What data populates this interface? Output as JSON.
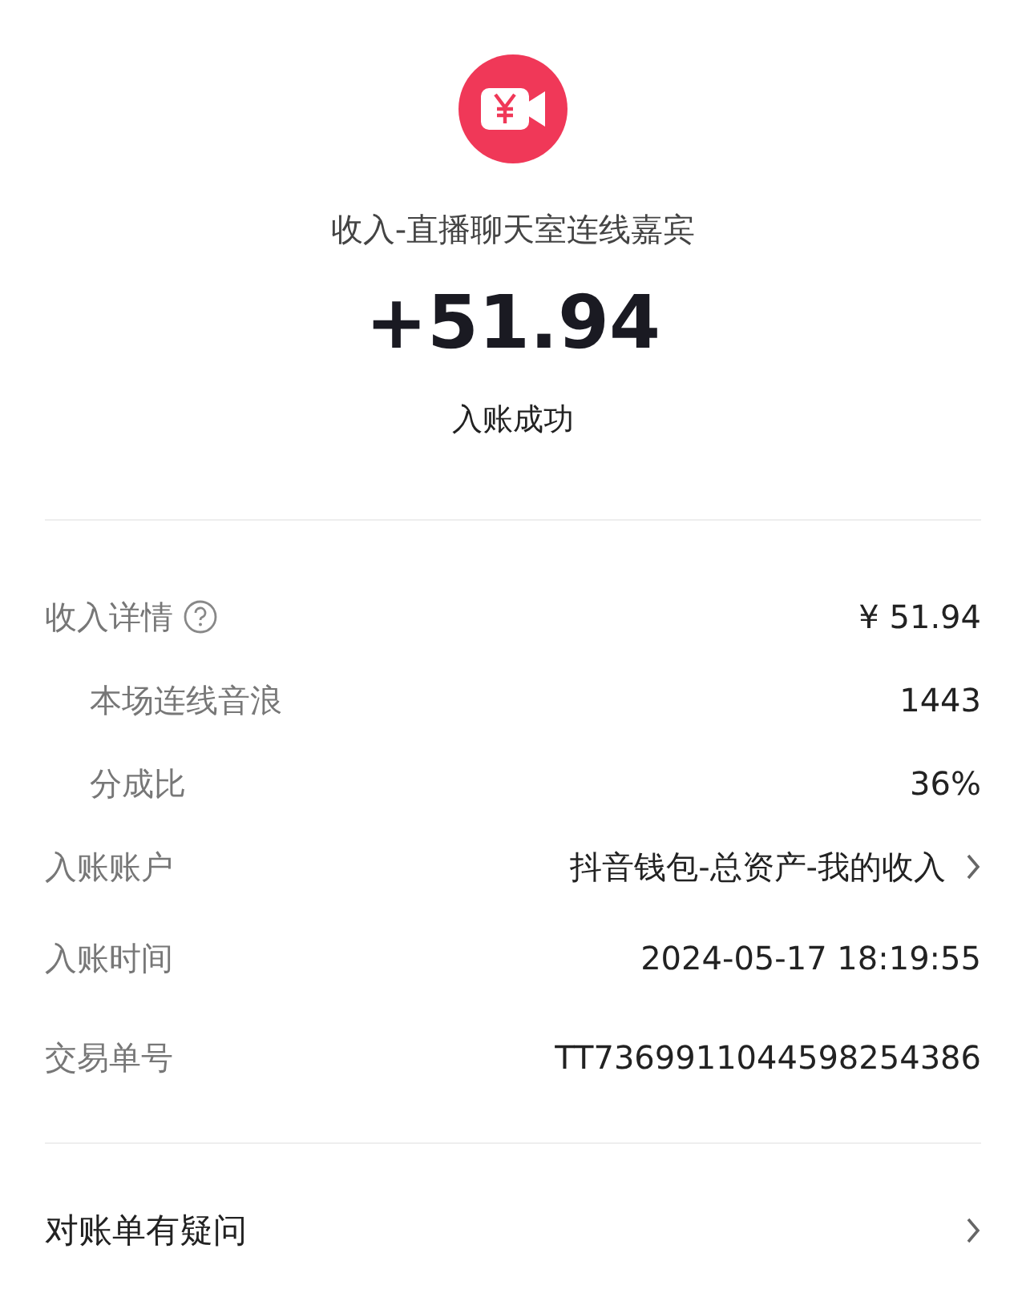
{
  "header": {
    "title": "收入-直播聊天室连线嘉宾",
    "amount": "+51.94",
    "status": "入账成功"
  },
  "details": [
    {
      "kind": "detail",
      "label": "收入详情",
      "value": "¥ 51.94"
    },
    {
      "kind": "sub",
      "label": "本场连线音浪",
      "value": "1443"
    },
    {
      "kind": "sub",
      "label": "分成比",
      "value": "36%"
    },
    {
      "kind": "link",
      "label": "入账账户",
      "value": "抖音钱包-总资产-我的收入"
    },
    {
      "kind": "plain",
      "label": "入账时间",
      "value": "2024-05-17 18:19:55"
    },
    {
      "kind": "plain",
      "label": "交易单号",
      "value": "TT7369911044598254386"
    }
  ],
  "footer_link": {
    "label": "对账单有疑问"
  }
}
